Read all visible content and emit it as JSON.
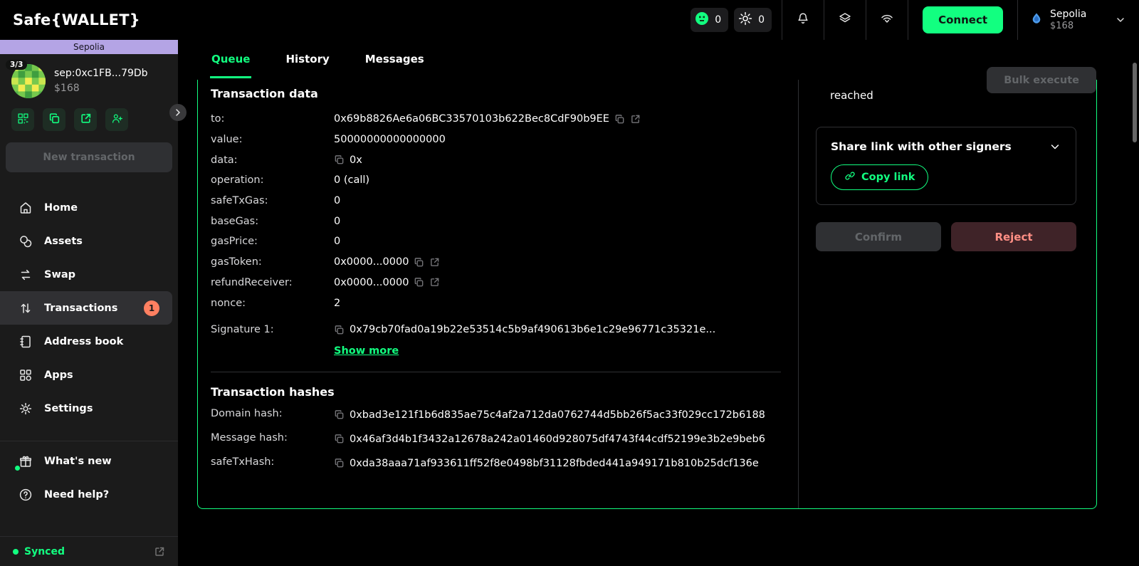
{
  "colors": {
    "accent": "#12FF80",
    "network_banner": "#B4A4E5",
    "badge": "#FF8061",
    "reject_bg": "#3F2328",
    "reject_text": "#FF8F85",
    "disabled_bg": "#2F3033",
    "disabled_text": "#636669"
  },
  "topbar": {
    "logo": "Safe{WALLET}",
    "token_badge_count": "0",
    "points_badge_count": "0",
    "connect_label": "Connect",
    "network": {
      "name": "Sepolia",
      "balance": "$168"
    }
  },
  "sidebar": {
    "network_banner": "Sepolia",
    "safe": {
      "threshold": "3/3",
      "address": "sep:0xc1FB...79Db",
      "balance": "$168"
    },
    "new_transaction_label": "New transaction",
    "nav": [
      {
        "label": "Home"
      },
      {
        "label": "Assets"
      },
      {
        "label": "Swap"
      },
      {
        "label": "Transactions",
        "badge": "1"
      },
      {
        "label": "Address book"
      },
      {
        "label": "Apps"
      },
      {
        "label": "Settings"
      }
    ],
    "whats_new_label": "What's new",
    "need_help_label": "Need help?",
    "sync_label": "Synced"
  },
  "main": {
    "tabs": {
      "queue": "Queue",
      "history": "History",
      "messages": "Messages"
    },
    "bulk_execute_label": "Bulk execute",
    "tx": {
      "title": "Transaction data",
      "rows": [
        {
          "key": "to:",
          "value": "0x69b8826Ae6a06BC33570103b622Bec8CdF90b9EE"
        },
        {
          "key": "value:",
          "value": "50000000000000000"
        },
        {
          "key": "data:",
          "value": "0x"
        },
        {
          "key": "operation:",
          "value": "0 (call)"
        },
        {
          "key": "safeTxGas:",
          "value": "0"
        },
        {
          "key": "baseGas:",
          "value": "0"
        },
        {
          "key": "gasPrice:",
          "value": "0"
        },
        {
          "key": "gasToken:",
          "value": "0x0000...0000"
        },
        {
          "key": "refundReceiver:",
          "value": "0x0000...0000"
        },
        {
          "key": "nonce:",
          "value": "2"
        }
      ],
      "signature": {
        "key": "Signature 1:",
        "value": "0x79cb70fad0a19b22e53514c5b9af490613b6e1c29e96771c35321e...",
        "show_more": "Show more"
      },
      "hashes_title": "Transaction hashes",
      "hashes": [
        {
          "key": "Domain hash:",
          "value": "0xbad3e121f1b6d835ae75c4af2a712da0762744d5bb26f5ac33f029cc172b6188"
        },
        {
          "key": "Message hash:",
          "value": "0x46af3d4b1f3432a12678a242a01460d928075df4743f44cdf52199e3b2e9beb6"
        },
        {
          "key": "safeTxHash:",
          "value": "0xda38aaa71af933611ff52f8e0498bf31128fbded441a949171b810b25dcf136e"
        }
      ]
    },
    "confirm_panel": {
      "reached_text": "reached",
      "share_title": "Share link with other signers",
      "copy_link_label": "Copy link",
      "confirm_label": "Confirm",
      "reject_label": "Reject"
    }
  }
}
